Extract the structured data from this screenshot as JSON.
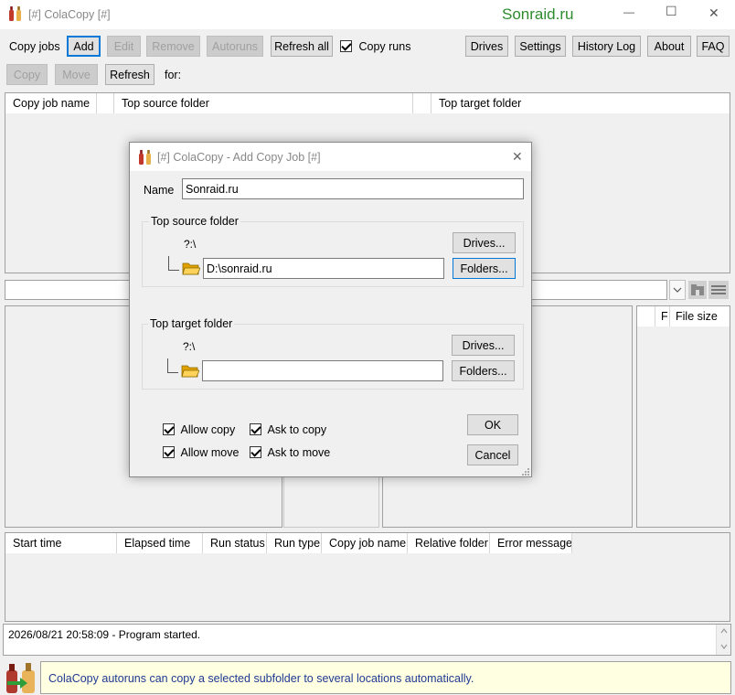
{
  "window": {
    "title": "[#] ColaCopy [#]",
    "brand": "Sonraid.ru",
    "minimize_glyph": "—",
    "maximize_glyph": "☐",
    "close_glyph": "✕"
  },
  "toolbar1": {
    "copy_jobs_label": "Copy jobs",
    "add": "Add",
    "edit": "Edit",
    "remove": "Remove",
    "autoruns": "Autoruns",
    "refresh_all": "Refresh all",
    "copy_runs": "Copy runs",
    "drives": "Drives",
    "settings": "Settings",
    "history_log": "History Log",
    "about": "About",
    "faq": "FAQ"
  },
  "toolbar2": {
    "copy": "Copy",
    "move": "Move",
    "refresh": "Refresh",
    "for_label": "for:"
  },
  "jobs_table": {
    "columns": [
      "Copy job name",
      "",
      "Top source folder",
      "",
      "Top target folder"
    ]
  },
  "files_table": {
    "columns": [
      "F",
      "File size"
    ]
  },
  "runs_table": {
    "columns": [
      "Start time",
      "Elapsed time",
      "Run status",
      "Run type",
      "Copy job name",
      "Relative folder",
      "Error message"
    ]
  },
  "log": {
    "line": "2026/08/21 20:58:09 - Program started."
  },
  "tip": {
    "text": "ColaCopy autoruns can copy a selected subfolder to several locations automatically."
  },
  "dialog": {
    "title": "[#] ColaCopy - Add Copy Job [#]",
    "close_glyph": "✕",
    "name_label": "Name",
    "name_value": "Sonraid.ru",
    "source_group": "Top source folder",
    "source_drive": "?:\\",
    "source_path": "D:\\sonraid.ru",
    "target_group": "Top target folder",
    "target_drive": "?:\\",
    "target_path": "",
    "drives_button": "Drives...",
    "folders_button": "Folders...",
    "allow_copy": "Allow copy",
    "ask_to_copy": "Ask to copy",
    "allow_move": "Allow move",
    "ask_to_move": "Ask to move",
    "ok": "OK",
    "cancel": "Cancel"
  },
  "colors": {
    "accent": "#0078d7",
    "brand": "#2e8b2e",
    "tip_bg": "#ffffe1",
    "tip_text": "#1f3a93"
  }
}
